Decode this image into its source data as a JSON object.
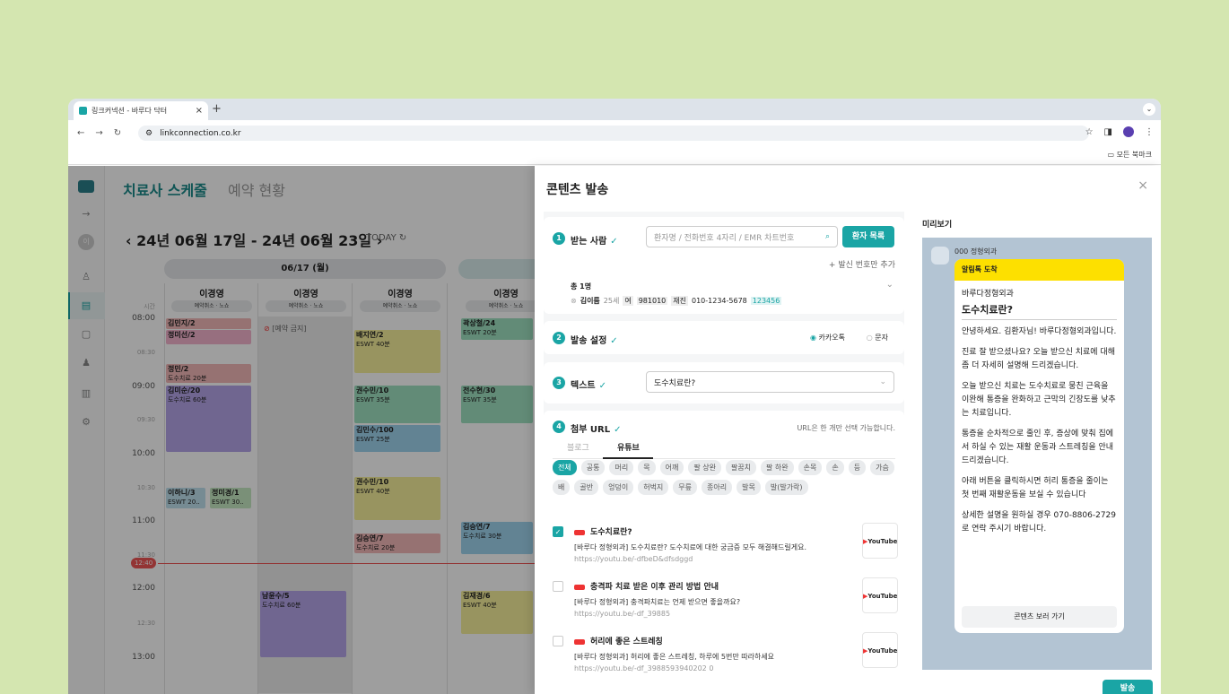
{
  "browser": {
    "tab_title": "링크커넥션 - 바루다 닥터",
    "tab_close": "×",
    "new_tab": "+",
    "url": "linkconnection.co.kr",
    "bookmark_all": "모든 북마크",
    "tab_menu": "⌄"
  },
  "app": {
    "sidebar_avatar": "이",
    "title_active": "치료사 스케줄",
    "title_inactive": "예약 현황",
    "date_range": "24년 06월 17일 - 24년 06월 23일",
    "today_label": "TODAY",
    "day_header": "06/17 (월)",
    "time_label": "시간",
    "columns": [
      {
        "name": "이경영",
        "sub": "예약취소 · 노쇼"
      },
      {
        "name": "이경영",
        "sub": "예약취소 · 노쇼"
      },
      {
        "name": "이경영",
        "sub": "예약취소 · 노쇼"
      },
      {
        "name": "이경영",
        "sub": "예약취소 · 노쇼"
      }
    ],
    "times": [
      "08:00",
      "08:30",
      "09:00",
      "09:30",
      "10:00",
      "10:30",
      "11:00",
      "11:30",
      "12:00",
      "12:30",
      "13:00"
    ],
    "blocked_label": "[예약 금지]",
    "now_label": "12:40",
    "events": [
      {
        "name": "김민지/2",
        "desc": ""
      },
      {
        "name": "정미선/2",
        "desc": ""
      },
      {
        "name": "정민/2",
        "desc": "도수치료 20분"
      },
      {
        "name": "김미순/20",
        "desc": "도수치료 60분"
      },
      {
        "name": "이하니/3",
        "desc": "ESWT 20.."
      },
      {
        "name": "정미경/1",
        "desc": "ESWT 30.."
      },
      {
        "name": "배지연/2",
        "desc": "ESWT 40분"
      },
      {
        "name": "권수민/10",
        "desc": "ESWT 35분"
      },
      {
        "name": "김민수/100",
        "desc": "ESWT 25분"
      },
      {
        "name": "권수민/10",
        "desc": "ESWT 40분"
      },
      {
        "name": "김승연/7",
        "desc": "도수치료 20분"
      },
      {
        "name": "남윤수/5",
        "desc": "도수치료 60분"
      },
      {
        "name": "곽상철/24",
        "desc": "ESWT 20분"
      },
      {
        "name": "전수현/30",
        "desc": "ESWT 35분"
      },
      {
        "name": "김승연/7",
        "desc": "도수치료 30분"
      },
      {
        "name": "김재경/6",
        "desc": "ESWT 40분"
      }
    ]
  },
  "modal": {
    "title": "콘텐츠 발송",
    "close": "×",
    "step1": {
      "num": "1",
      "title": "받는 사람",
      "search_placeholder": "환자명 / 전화번호 4자리 / EMR 차트번호",
      "list_button": "환자 목록",
      "add_number": "발신 번호만 추가",
      "total": "총 1명",
      "patient": {
        "name": "김이름",
        "age": "25세",
        "sex": "여",
        "chart": "981010",
        "visit": "재진",
        "phone": "010-1234-5678",
        "code": "123456"
      }
    },
    "step2": {
      "num": "2",
      "title": "발송 설정",
      "opt1": "카카오톡",
      "opt2": "문자"
    },
    "step3": {
      "num": "3",
      "title": "텍스트",
      "value": "도수치료란?"
    },
    "step4": {
      "num": "4",
      "title": "첨부 URL",
      "note": "URL은 한 개만 선택 가능합니다.",
      "tab1": "블로그",
      "tab2": "유튜브",
      "chips": [
        "전체",
        "공통",
        "머리",
        "목",
        "어깨",
        "팔 상완",
        "팔꿈치",
        "팔 하완",
        "손목",
        "손",
        "등",
        "가슴",
        "배",
        "골반",
        "엉덩이",
        "허벅지",
        "무릎",
        "종아리",
        "발목",
        "발(발가락)"
      ],
      "videos": [
        {
          "title": "도수치료란?",
          "desc": "[바루다 정형외과] 도수치료란? 도수치료에 대한 궁금증 모두 해결해드릴게요.",
          "url": "https://youtu.be/-dfbeD&dfsdggd",
          "thumb": "YouTube"
        },
        {
          "title": "충격파 치료 받은 이후 관리 방법 안내",
          "desc": "[바루다 정형외과] 충격파치료는 언제 받으면 좋을까요?",
          "url": "https://youtu.be/-df_39885",
          "thumb": "YouTube"
        },
        {
          "title": "허리에 좋은 스트레칭",
          "desc": "[바루다 정형외과] 허리에 좋은 스트레칭, 하루에 5번만 따라하세요",
          "url": "https://youtu.be/-df_3988593940202 0",
          "thumb": "YouTube"
        }
      ]
    },
    "preview": {
      "label": "미리보기",
      "sender": "000 정형외과",
      "header": "알림톡 도착",
      "clinic": "바루다정형외과",
      "title": "도수치료란?",
      "paragraphs": [
        "안녕하세요. 김환자님! 바루다정형외과입니다.",
        "진료 잘 받으셨나요? 오늘 받으신 치료에 대해 좀 더 자세히 설명해 드리겠습니다.",
        "오늘 받으신 치료는 도수치료로 뭉친 근육을 이완해 통증을 완화하고 근막의 긴장도를 낮추는 치료입니다.",
        "통증을 순차적으로 줄인 후, 증상에 맞춰 집에서 하실 수 있는 재활 운동과 스트레칭을 안내드리겠습니다.",
        "아래 버튼을 클릭하시면 허리 통증을 줄이는 첫 번째 재활운동을 보실 수 있습니다",
        "상세한 설명을 원하실 경우 070-8806-2729로 연락 주시기 바랍니다."
      ],
      "button": "콘텐츠 보러 가기"
    },
    "send_button": "발송"
  }
}
